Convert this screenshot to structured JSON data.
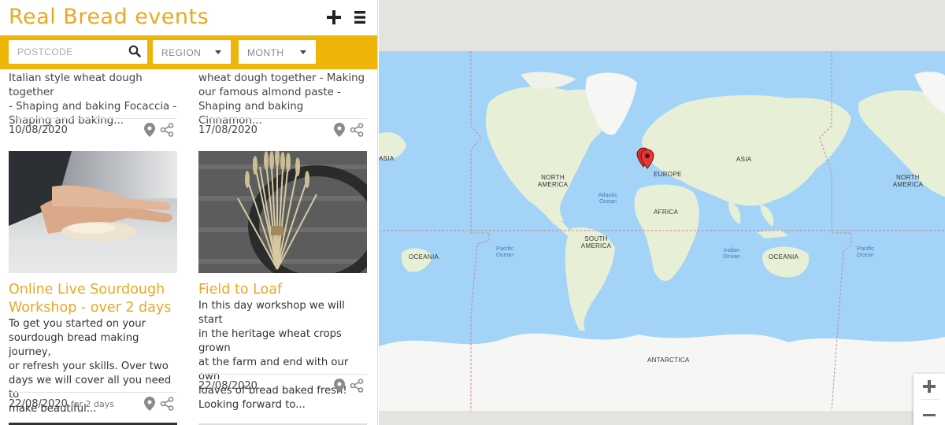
{
  "header": {
    "title": "Real Bread events"
  },
  "filters": {
    "postcode_placeholder": "POSTCODE",
    "region_label": "REGION",
    "month_label": "MONTH"
  },
  "cards_top": [
    {
      "snippet_lines": [
        "Italian style wheat dough together",
        "- Shaping and baking Focaccia -",
        "Shaping and baking..."
      ],
      "date": "10/08/2020"
    },
    {
      "snippet_lines": [
        "wheat dough together - Making",
        "our famous almond paste -",
        "Shaping and baking Cinnamon..."
      ],
      "date": "17/08/2020"
    }
  ],
  "cards": [
    {
      "title_lines": [
        "Online Live Sourdough",
        "Workshop - over 2 days"
      ],
      "desc_lines": [
        "To get you started on your",
        "sourdough bread making journey,",
        "or refresh your skills. Over two",
        "days we will cover all you need to",
        "make beautiful..."
      ],
      "date": "22/08/2020",
      "duration": "for 2 days"
    },
    {
      "title_lines": [
        "Field to Loaf"
      ],
      "desc_lines": [
        "In this day workshop we will start",
        "in the heritage wheat crops grown",
        "at the farm and end with our own",
        "loaves of bread baked fresh!",
        "Looking forward to..."
      ],
      "date": "22/08/2020",
      "duration": ""
    }
  ],
  "map": {
    "continent_labels": [
      "ASIA",
      "NORTH AMERICA",
      "NORTH AMERICA",
      "EUROPE",
      "ASIA",
      "AFRICA",
      "SOUTH AMERICA",
      "OCEANIA",
      "OCEANIA",
      "ANTARCTICA"
    ],
    "ocean_labels": [
      "Atlantic Ocean",
      "Pacific Ocean",
      "Indian Ocean",
      "Pacific Ocean"
    ],
    "marker_count": 3
  },
  "colors": {
    "accent": "#e9a822",
    "filter_bar": "#eeb408",
    "water": "#a3d4f7",
    "land": "#e8efd7",
    "ice": "#f6f6f4"
  },
  "icons": {
    "add": "plus-icon",
    "menu": "menu-icon",
    "search": "search-icon",
    "pin": "map-pin-icon",
    "share": "share-icon"
  }
}
